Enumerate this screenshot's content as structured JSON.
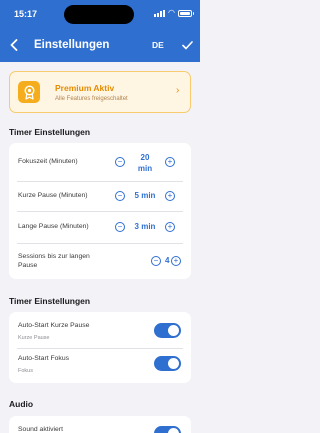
{
  "status": {
    "time": "15:17"
  },
  "nav": {
    "title": "Einstellungen",
    "language": "DE"
  },
  "premium": {
    "title": "Premium Aktiv",
    "subtitle": "Alle Features freigeschaltet"
  },
  "timer_section": {
    "title": "Timer Einstellungen",
    "rows": [
      {
        "label": "Fokuszeit (Minuten)",
        "value": "20\nmin"
      },
      {
        "label": "Kurze Pause (Minuten)",
        "value": "5 min"
      },
      {
        "label": "Lange Pause (Minuten)",
        "value": "3 min"
      },
      {
        "label": "Sessions bis zur langen Pause",
        "value": "4"
      }
    ]
  },
  "auto_section": {
    "title": "Timer Einstellungen",
    "rows": [
      {
        "label": "Auto-Start Kurze Pause",
        "sub": "Kurze Pause",
        "on": true
      },
      {
        "label": "Auto-Start Fokus",
        "sub": "Fokus",
        "on": true
      }
    ]
  },
  "audio_section": {
    "title": "Audio",
    "rows": [
      {
        "label": "Sound aktiviert",
        "on": true
      }
    ]
  },
  "colors": {
    "accent": "#2f6fd0",
    "premium": "#e48c00",
    "background": "#f2f2f7"
  }
}
